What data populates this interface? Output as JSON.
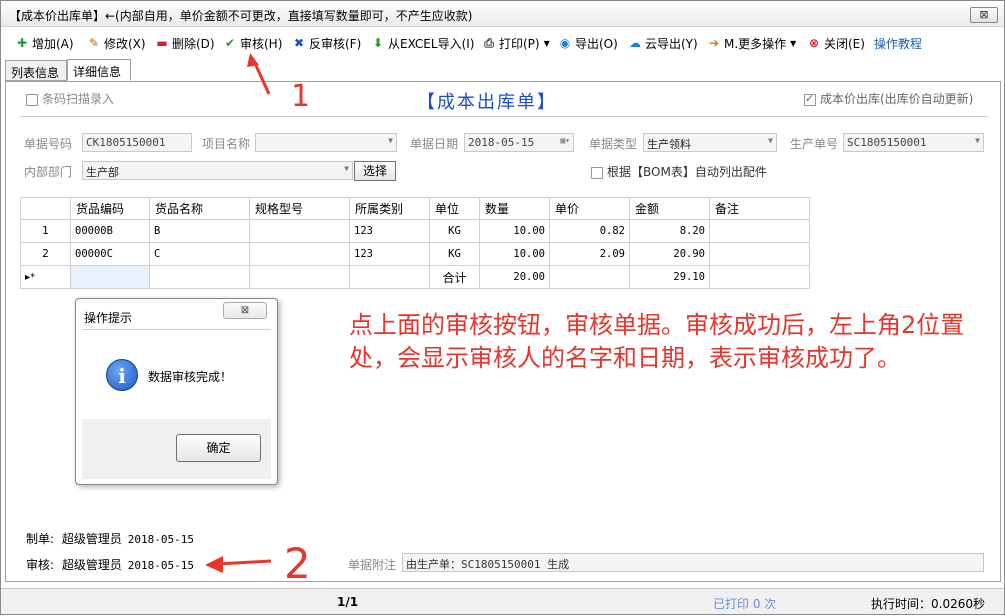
{
  "window": {
    "title": "【成本价出库单】←(内部自用，单价金额不可更改，直接填写数量即可，不产生应收款)",
    "close_glyph": "⊠"
  },
  "toolbar": {
    "add": "增加(A)",
    "edit": "修改(X)",
    "delete": "删除(D)",
    "audit": "审核(H)",
    "unaudit": "反审核(F)",
    "import_excel": "从EXCEL导入(I)",
    "print": "打印(P)",
    "export": "导出(O)",
    "cloud_export": "云导出(Y)",
    "more": "M.更多操作",
    "close": "关闭(E)",
    "tutorial": "操作教程"
  },
  "tabs": [
    "列表信息",
    "详细信息"
  ],
  "form": {
    "barcode_scan": "条码扫描录入",
    "title": "【成本出库单】",
    "cost_price_out": "成本价出库(出库价自动更新)",
    "doc_no_label": "单据号码",
    "doc_no": "CK1805150001",
    "project_label": "项目名称",
    "project": "",
    "date_label": "单据日期",
    "date": "2018-05-15",
    "doc_type_label": "单据类型",
    "doc_type": "生产领料",
    "prod_no_label": "生产单号",
    "prod_no": "SC1805150001",
    "dept_label": "内部部门",
    "dept": "生产部",
    "select_button": "选择",
    "bom_auto": "根据【BOM表】自动列出配件"
  },
  "grid": {
    "headers": [
      "货品编码",
      "货品名称",
      "规格型号",
      "所属类别",
      "单位",
      "数量",
      "单价",
      "金额",
      "备注"
    ],
    "rows": [
      {
        "rn": "1",
        "code": "00000B",
        "name": "B",
        "spec": "",
        "category": "123",
        "unit": "KG",
        "qty": "10.00",
        "price": "0.82",
        "amount": "8.20",
        "note": ""
      },
      {
        "rn": "2",
        "code": "00000C",
        "name": "C",
        "spec": "",
        "category": "123",
        "unit": "KG",
        "qty": "10.00",
        "price": "2.09",
        "amount": "20.90",
        "note": ""
      }
    ],
    "new_row_marker": "▸*",
    "total_label": "合计",
    "total_qty": "20.00",
    "total_amount": "29.10"
  },
  "dialog": {
    "title": "操作提示",
    "close_glyph": "⊠",
    "icon": "i",
    "message": "数据审核完成！",
    "ok": "确定"
  },
  "annotation": {
    "text": "点上面的审核按钮，审核单据。审核成功后，左上角2位置处，会显示审核人的名字和日期，表示审核成功了。",
    "marker1": "1",
    "marker2": "2",
    "color": "#e8342b"
  },
  "footer": {
    "maker_label": "制单:",
    "maker": "超级管理员",
    "maker_date": "2018-05-15",
    "auditor_label": "审核:",
    "auditor": "超级管理员",
    "audit_date": "2018-05-15",
    "note_label": "单据附注",
    "note": "由生产单：SC1805150001 生成"
  },
  "status": {
    "page": "1/1",
    "printed": "已打印 0 次",
    "exec_time": "执行时间：0.0260秒"
  }
}
